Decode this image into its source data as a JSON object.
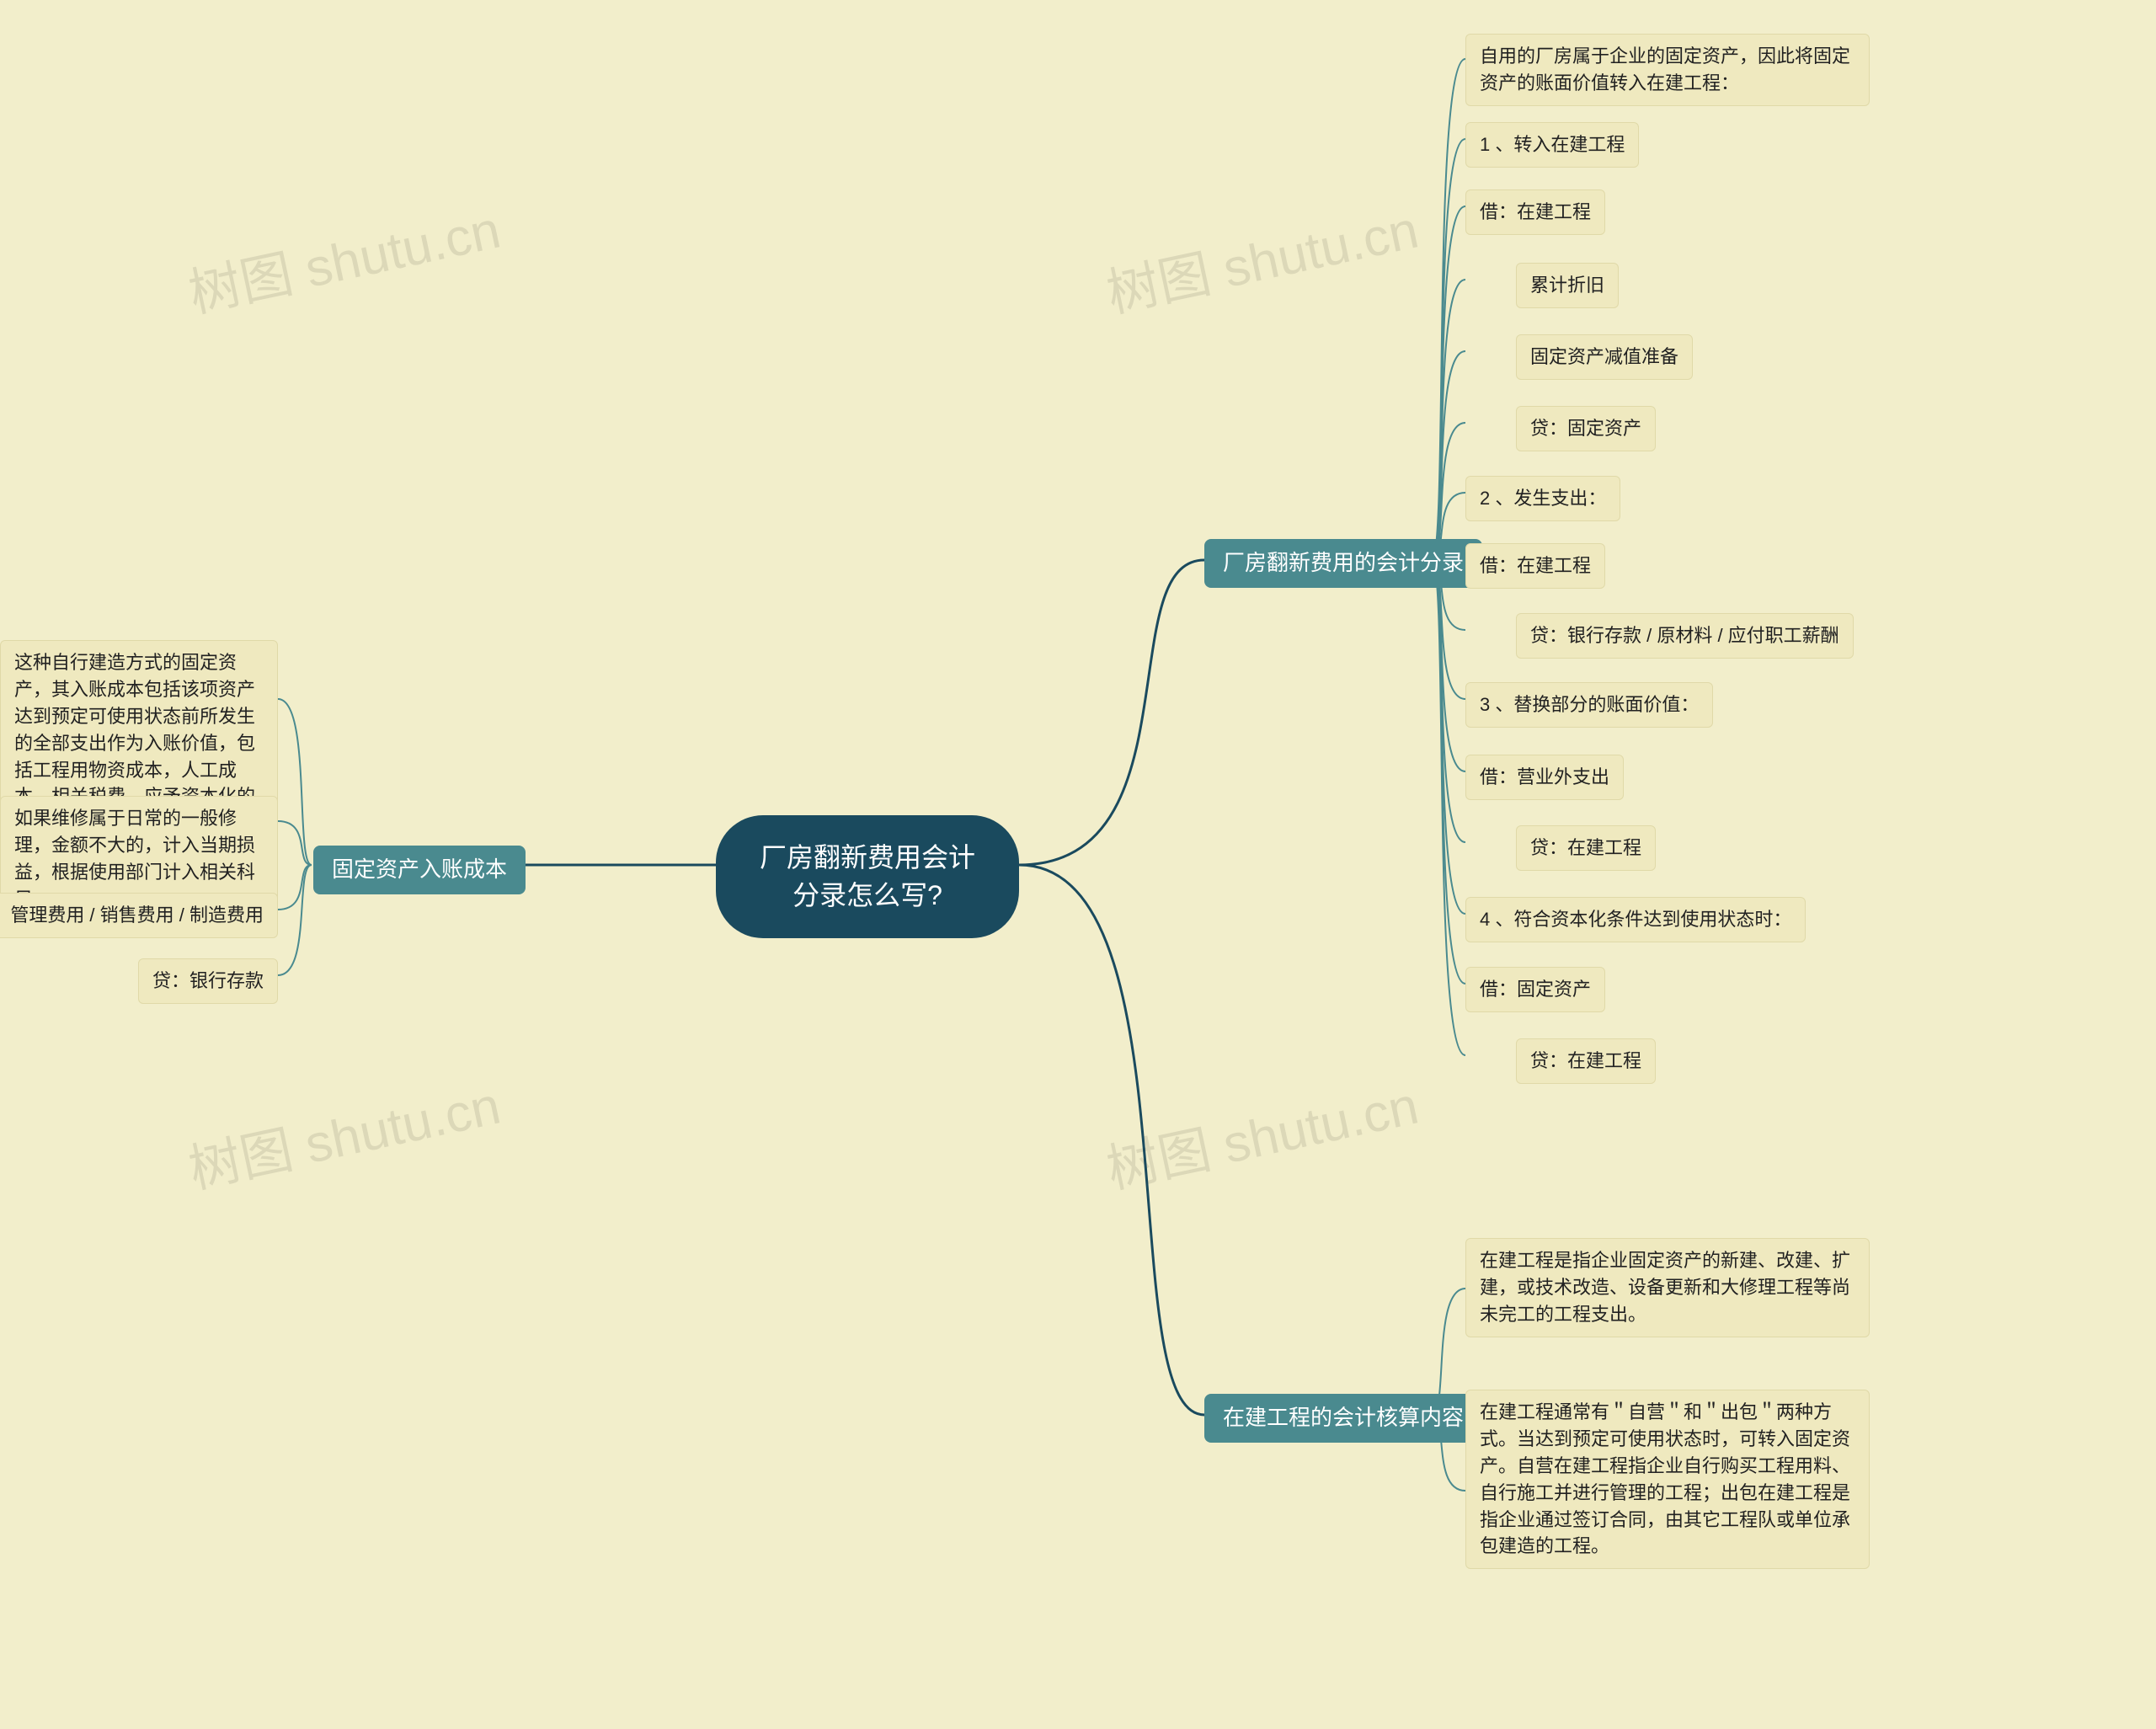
{
  "root": {
    "title": "厂房翻新费用会计分录怎么写?"
  },
  "branches": {
    "b1": {
      "label": "厂房翻新费用的会计分录"
    },
    "b2": {
      "label": "在建工程的会计核算内容"
    },
    "b3": {
      "label": "固定资产入账成本"
    }
  },
  "leaves": {
    "l1_01": "自用的厂房属于企业的固定资产，因此将固定资产的账面价值转入在建工程：",
    "l1_02": "1 、转入在建工程",
    "l1_03": "借：在建工程",
    "l1_04": "累计折旧",
    "l1_05": "固定资产减值准备",
    "l1_06": "贷：固定资产",
    "l1_07": "2 、发生支出：",
    "l1_08": "借：在建工程",
    "l1_09": "贷：银行存款 / 原材料 / 应付职工薪酬",
    "l1_10": "3 、替换部分的账面价值：",
    "l1_11": "借：营业外支出",
    "l1_12": "贷：在建工程",
    "l1_13": "4 、符合资本化条件达到使用状态时：",
    "l1_14": "借：固定资产",
    "l1_15": "贷：在建工程",
    "l2_01": "在建工程是指企业固定资产的新建、改建、扩建，或技术改造、设备更新和大修理工程等尚未完工的工程支出。",
    "l2_02": "在建工程通常有＂自营＂和＂出包＂两种方式。当达到预定可使用状态时，可转入固定资产。自营在建工程指企业自行购买工程用料、自行施工并进行管理的工程；出包在建工程是指企业通过签订合同，由其它工程队或单位承包建造的工程。",
    "l3_01": "这种自行建造方式的固定资产，其入账成本包括该项资产达到预定可使用状态前所发生的全部支出作为入账价值，包括工程用物资成本，人工成本，相关税费，应予资本化的借款费用，间接费用等。",
    "l3_02": "如果维修属于日常的一般修理，金额不大的，计入当期损益，根据使用部门计入相关科目：",
    "l3_03": "借：管理费用 / 销售费用 / 制造费用",
    "l3_04": "贷：银行存款"
  },
  "watermark": "树图 shutu.cn"
}
